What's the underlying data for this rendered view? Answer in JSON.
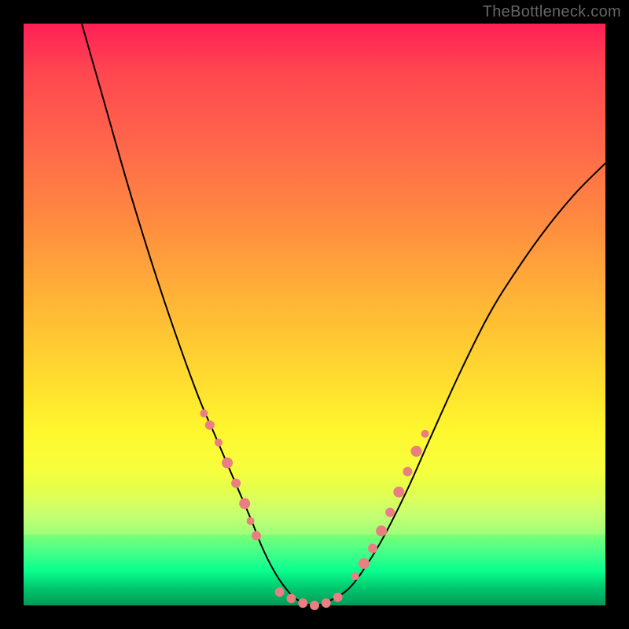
{
  "attribution": "TheBottleneck.com",
  "chart_data": {
    "type": "line",
    "title": "",
    "xlabel": "",
    "ylabel": "",
    "xlim": [
      0,
      100
    ],
    "ylim": [
      0,
      100
    ],
    "grid": false,
    "legend": false,
    "series": [
      {
        "name": "curve",
        "stroke": "#000000",
        "stroke_width": 2,
        "x": [
          10,
          14,
          18,
          22,
          26,
          30,
          33,
          36,
          39,
          41,
          43,
          45,
          47,
          50,
          53,
          56,
          59,
          62,
          66,
          70,
          75,
          80,
          85,
          90,
          95,
          100
        ],
        "y": [
          100,
          86,
          72,
          59,
          47,
          36,
          29,
          22,
          15,
          10,
          6,
          3,
          1,
          0,
          1,
          3,
          7,
          12,
          20,
          29,
          40,
          50,
          58,
          65,
          71,
          76
        ]
      },
      {
        "name": "markers-left",
        "marker_color": "#eb7e82",
        "x": [
          31.0,
          32.0,
          33.5,
          35.0,
          36.5,
          38.0,
          39.0,
          40.0
        ],
        "y": [
          33.0,
          31.0,
          28.0,
          24.5,
          21.0,
          17.5,
          14.5,
          12.0
        ],
        "r": [
          5,
          6,
          5,
          7,
          6,
          7,
          5,
          6
        ]
      },
      {
        "name": "markers-bottom",
        "marker_color": "#eb7e82",
        "x": [
          44.0,
          46.0,
          48.0,
          50.0,
          52.0,
          54.0
        ],
        "y": [
          2.3,
          1.2,
          0.4,
          0.0,
          0.4,
          1.4
        ],
        "r": [
          6,
          6,
          6,
          6,
          6,
          6
        ]
      },
      {
        "name": "markers-right",
        "marker_color": "#eb7e82",
        "x": [
          57.0,
          58.5,
          60.0,
          61.5,
          63.0,
          64.5,
          66.0,
          67.5,
          69.0
        ],
        "y": [
          5.0,
          7.2,
          9.8,
          12.8,
          16.0,
          19.5,
          23.0,
          26.5,
          29.5
        ],
        "r": [
          5,
          7,
          6,
          7,
          6,
          7,
          6,
          7,
          5
        ]
      }
    ]
  }
}
